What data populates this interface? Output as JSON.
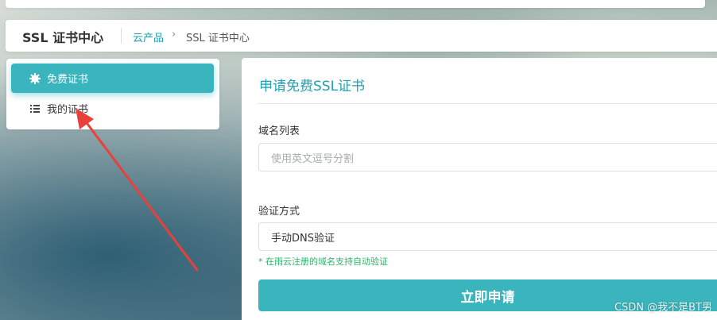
{
  "header": {
    "title": "SSL 证书中心",
    "breadcrumb_link": "云产品",
    "breadcrumb_sep": "›",
    "breadcrumb_current": "SSL 证书中心"
  },
  "sidebar": {
    "items": [
      {
        "label": "免费证书",
        "icon": "gear-icon",
        "active": true
      },
      {
        "label": "我的证书",
        "icon": "list-icon",
        "active": false
      }
    ]
  },
  "form": {
    "title": "申请免费SSL证书",
    "domain_label": "域名列表",
    "domain_placeholder": "使用英文逗号分割",
    "verify_label": "验证方式",
    "verify_value": "手动DNS验证",
    "hint": "* 在雨云注册的域名支持自动验证",
    "submit_label": "立即申请"
  },
  "watermark": "CSDN @我不是BT男",
  "colors": {
    "accent": "#3ab5be",
    "link": "#20a0b0",
    "hint_green": "#2bb46a",
    "annotation_arrow": "#e8413b"
  }
}
